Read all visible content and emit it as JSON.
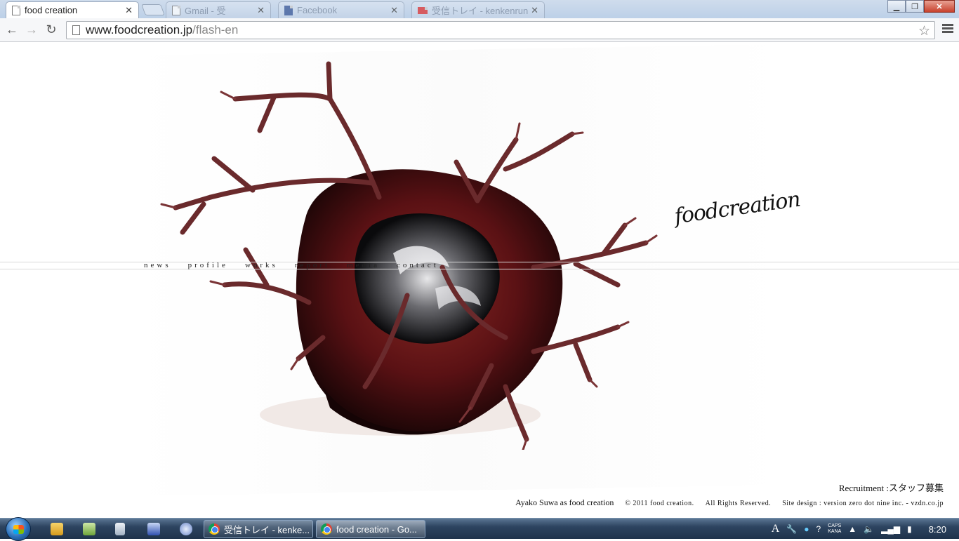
{
  "browser": {
    "tabs": [
      {
        "title": "food creation",
        "active": true
      },
      {
        "title": "Gmail - 受",
        "active": false
      },
      {
        "title": "Facebook",
        "active": false
      },
      {
        "title": "受信トレイ - kenkenrunrun",
        "active": false
      }
    ],
    "url_host": "www.foodcreation.jp",
    "url_path": "/flash-en"
  },
  "site": {
    "logo": "foodcreation",
    "nav": [
      "news",
      "profile",
      "works",
      "report",
      "media",
      "contact"
    ],
    "recruitment": "Recruitment :スタッフ募集",
    "author": "Ayako Suwa as food creation",
    "copyright": "© 2011  food creation.",
    "rights": "All Rights Reserved.",
    "credit": "Site design : version zero dot nine inc. - vzdn.co.jp"
  },
  "taskbar": {
    "tasks": [
      {
        "label": "受信トレイ - kenke...",
        "active": false
      },
      {
        "label": "food creation - Go...",
        "active": true
      }
    ],
    "tray_caps": "CAPS",
    "tray_kana": "KANA",
    "clock": "8:20"
  },
  "colors": {
    "accent_dark": "#3a0b0e",
    "accent_red": "#7a1b1f",
    "branch": "#6a2a2c"
  }
}
